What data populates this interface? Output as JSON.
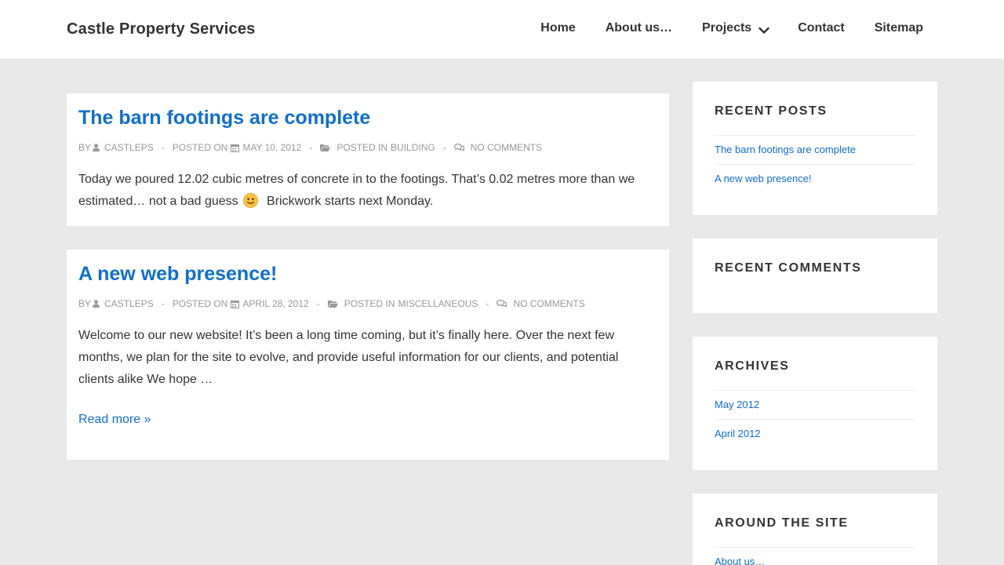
{
  "header": {
    "site_title": "Castle Property Services",
    "nav": [
      {
        "label": "Home"
      },
      {
        "label": "About us…"
      },
      {
        "label": "Projects"
      },
      {
        "label": "Contact"
      },
      {
        "label": "Sitemap"
      }
    ]
  },
  "posts": [
    {
      "title": "The barn footings are complete",
      "meta": {
        "by": "By",
        "author": "castleps",
        "posted_on": "Posted on",
        "date": "May 10, 2012",
        "posted_in": "Posted in",
        "category": "Building",
        "comments": "No Comments"
      },
      "body_part1": "Today we poured 12.02 cubic metres of concrete in to the footings.   That’s 0.02 metres more than we estimated… not a bad guess",
      "body_part2": "  Brickwork starts next Monday."
    },
    {
      "title": "A new web presence!",
      "meta": {
        "by": "By",
        "author": "castleps",
        "posted_on": "Posted on",
        "date": "April 28, 2012",
        "posted_in": "Posted in",
        "category": "Miscellaneous",
        "comments": "No Comments"
      },
      "body": "Welcome to our new website! It’s been a long time coming, but it’s finally here. Over the next few months, we plan for the site to evolve, and provide useful information for our clients, and potential clients alike We hope …",
      "read_more": "Read more »"
    }
  ],
  "sidebar": {
    "recent_posts": {
      "title": "Recent Posts",
      "items": [
        "The barn footings are complete",
        "A new web presence!"
      ]
    },
    "recent_comments": {
      "title": "Recent Comments"
    },
    "archives": {
      "title": "Archives",
      "items": [
        "May 2012",
        "April 2012"
      ]
    },
    "around_the_site": {
      "title": "Around the site",
      "items": [
        "About us…"
      ]
    }
  },
  "colors": {
    "link": "#0d6fcf",
    "background": "#e9e9e9",
    "text": "#333333",
    "meta": "#999999"
  }
}
